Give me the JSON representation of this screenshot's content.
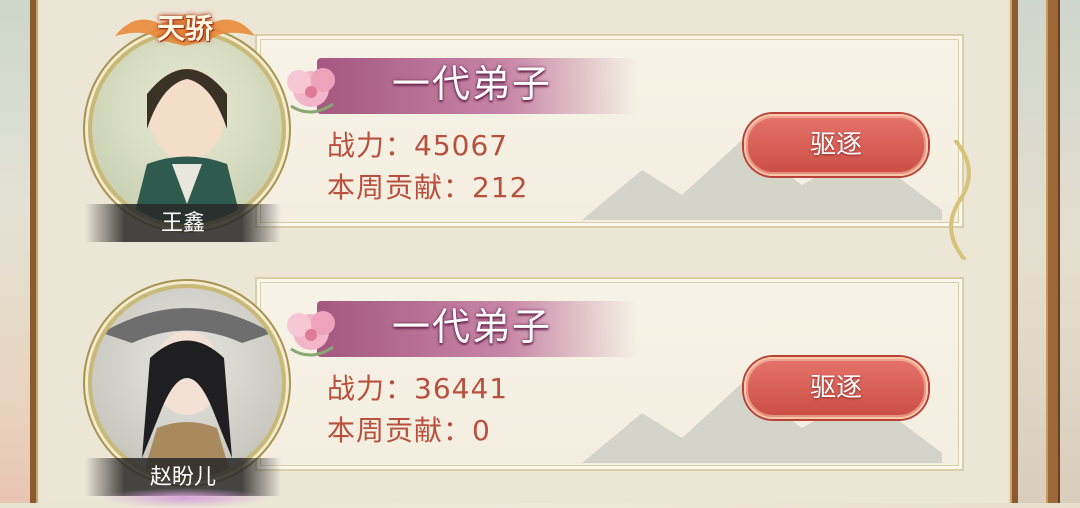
{
  "members": [
    {
      "title_badge": "天骄",
      "name": "王鑫",
      "rank": "一代弟子",
      "power_label": "战力：",
      "power": "45067",
      "contrib_label": "本周贡献：",
      "contrib": "212",
      "expel_label": "驱逐"
    },
    {
      "name": "赵盼儿",
      "rank": "一代弟子",
      "power_label": "战力：",
      "power": "36441",
      "contrib_label": "本周贡献：",
      "contrib": "0",
      "expel_label": "驱逐"
    }
  ],
  "colors": {
    "stat_text": "#b9503e",
    "button": "#d9584f",
    "rank_band": "#9c3c72",
    "frame": "#8b5a2e"
  }
}
